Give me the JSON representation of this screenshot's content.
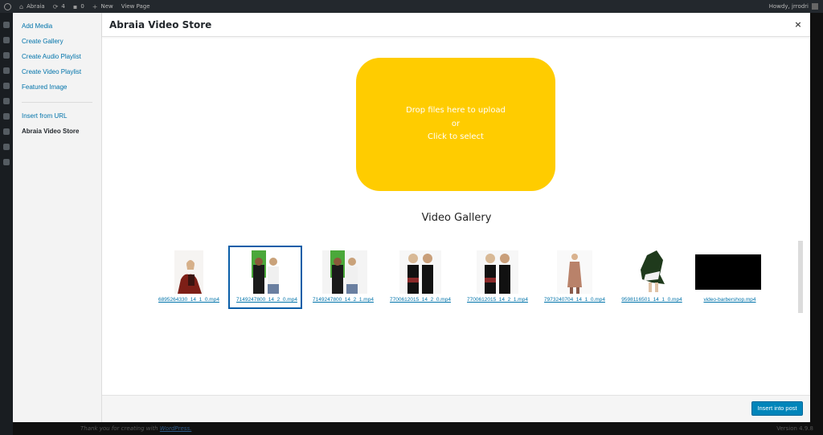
{
  "adminbar": {
    "site_name": "Abraia",
    "updates_count": "4",
    "comments_count": "0",
    "new_label": "New",
    "view_page": "View Page",
    "howdy": "Howdy, jrrodri"
  },
  "footer": {
    "thanks_text": "Thank you for creating with",
    "wordpress_link": "WordPress.",
    "version": "Version 4.9.8"
  },
  "modal": {
    "title": "Abraia Video Store",
    "close_glyph": "×",
    "menu": {
      "items": [
        {
          "label": "Add Media"
        },
        {
          "label": "Create Gallery"
        },
        {
          "label": "Create Audio Playlist"
        },
        {
          "label": "Create Video Playlist"
        },
        {
          "label": "Featured Image"
        },
        {
          "label": "Insert from URL"
        },
        {
          "label": "Abraia Video Store"
        }
      ],
      "active_index": 6
    },
    "dropzone": {
      "line1": "Drop files here to upload",
      "line2": "or",
      "line3": "Click to select",
      "color": "#ffcc00"
    },
    "gallery_title": "Video Gallery",
    "videos": [
      {
        "filename": "6895264330_14_1_0.mp4",
        "selected": false
      },
      {
        "filename": "7149247800_14_2_0.mp4",
        "selected": true
      },
      {
        "filename": "7149247800_14_2_1.mp4",
        "selected": false
      },
      {
        "filename": "7700612015_14_2_0.mp4",
        "selected": false
      },
      {
        "filename": "7700612015_14_2_1.mp4",
        "selected": false
      },
      {
        "filename": "7973240704_14_1_0.mp4",
        "selected": false
      },
      {
        "filename": "9598116501_14_1_0.mp4",
        "selected": false
      },
      {
        "filename": "video-barbershop.mp4",
        "selected": false
      }
    ],
    "insert_button": "Insert into post",
    "accent_color": "#0085ba"
  }
}
